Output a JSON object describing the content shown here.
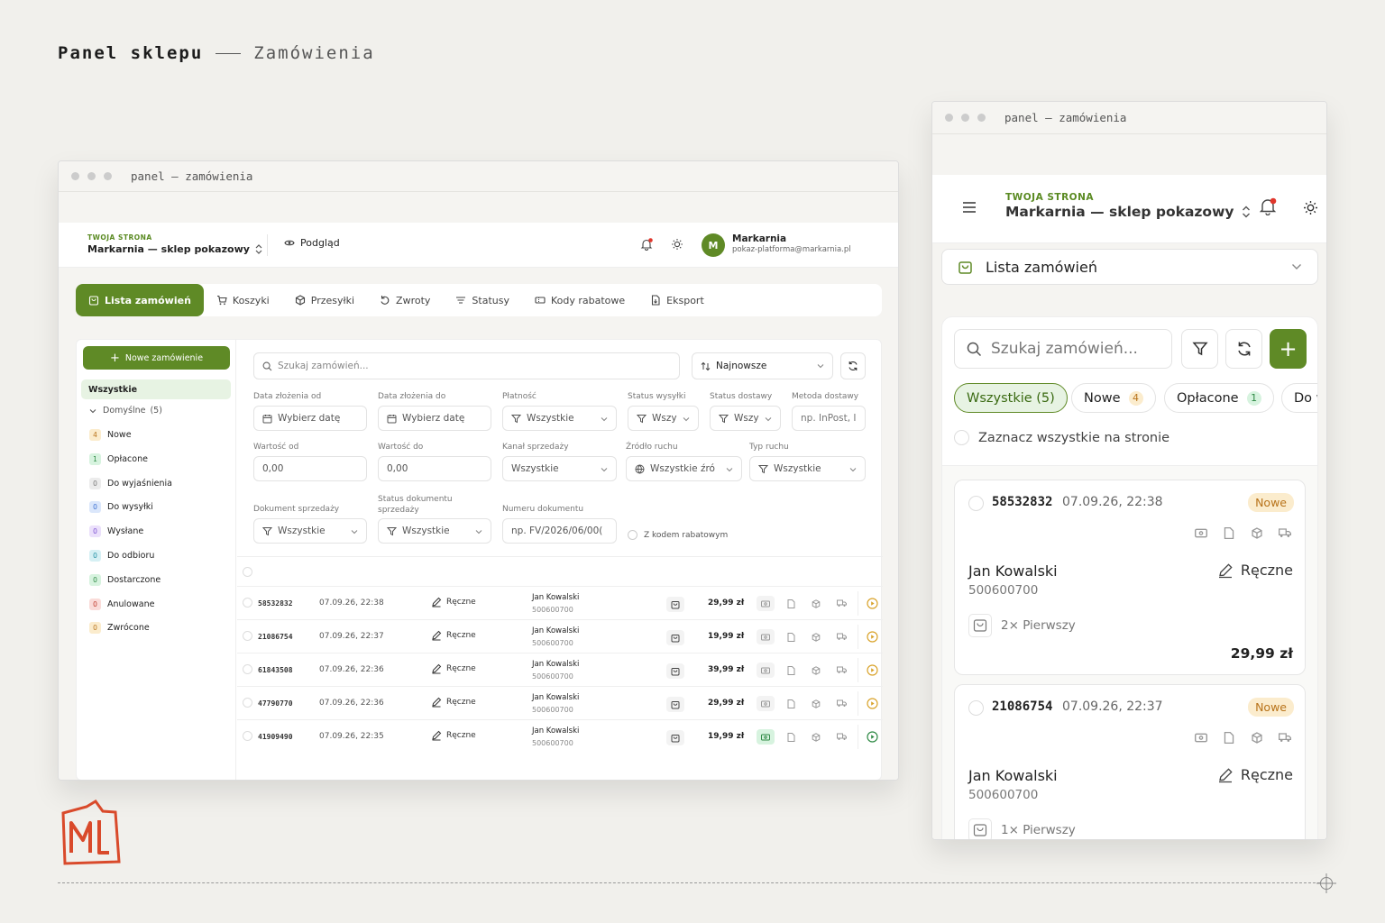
{
  "page": {
    "title": "Panel sklepu",
    "subtitle": "Zamówienia"
  },
  "desktop": {
    "window_title": "panel — zamówienia",
    "store_label": "TWOJA STRONA",
    "store_name": "Markarnia — sklep pokazowy",
    "preview": "Podgląd",
    "user": {
      "initial": "M",
      "name": "Markarnia",
      "email": "pokaz-platforma@markarnia.pl"
    },
    "tabs": [
      "Lista zamówień",
      "Koszyki",
      "Przesyłki",
      "Zwroty",
      "Statusy",
      "Kody rabatowe",
      "Eksport"
    ],
    "new_order": "Nowe zamówienie",
    "sidebar": {
      "all": "Wszystkie",
      "group": "Domyślne",
      "group_count": "(5)",
      "items": [
        {
          "count": "4",
          "label": "Nowe",
          "color": "#b8731a",
          "bg": "#fbeccd"
        },
        {
          "count": "1",
          "label": "Opłacone",
          "color": "#2f8a45",
          "bg": "#d7f3df"
        },
        {
          "count": "0",
          "label": "Do wyjaśnienia",
          "color": "#777",
          "bg": "#ececec"
        },
        {
          "count": "0",
          "label": "Do wysyłki",
          "color": "#3b6fd1",
          "bg": "#dbe7fb"
        },
        {
          "count": "0",
          "label": "Wysłane",
          "color": "#7b4fd1",
          "bg": "#ebe0fb"
        },
        {
          "count": "0",
          "label": "Do odbioru",
          "color": "#1f8fa3",
          "bg": "#d6f0f4"
        },
        {
          "count": "0",
          "label": "Dostarczone",
          "color": "#2f8a45",
          "bg": "#d7f3df"
        },
        {
          "count": "0",
          "label": "Anulowane",
          "color": "#c0392b",
          "bg": "#fadcd9"
        },
        {
          "count": "0",
          "label": "Zwrócone",
          "color": "#b8731a",
          "bg": "#fbeccd"
        }
      ]
    },
    "search_placeholder": "Szukaj zamówień...",
    "sort": "Najnowsze",
    "filters": {
      "date_from_label": "Data złożenia od",
      "date_from": "Wybierz datę",
      "date_to_label": "Data złożenia do",
      "date_to": "Wybierz datę",
      "payment_label": "Płatność",
      "payment": "Wszystkie",
      "ship_status_label": "Status wysyłki",
      "ship_status": "Wszy",
      "deliv_status_label": "Status dostawy",
      "deliv_status": "Wszy",
      "deliv_method_label": "Metoda dostawy",
      "deliv_method": "np. InPost, I",
      "value_from_label": "Wartość od",
      "value_from": "0,00",
      "value_to_label": "Wartość do",
      "value_to": "0,00",
      "channel_label": "Kanał sprzedaży",
      "channel": "Wszystkie",
      "traffic_src_label": "Źródło ruchu",
      "traffic_src": "Wszystkie źró",
      "traffic_type_label": "Typ ruchu",
      "traffic_type": "Wszystkie",
      "doc_label": "Dokument sprzedaży",
      "doc": "Wszystkie",
      "doc_status_label": "Status dokumentu sprzedaży",
      "doc_status": "Wszystkie",
      "doc_number_label": "Numeru dokumentu",
      "doc_number": "np. FV/2026/06/00(",
      "discount": "Z kodem rabatowym"
    },
    "orders": [
      {
        "id": "58532832",
        "date": "07.09.26, 22:38",
        "source": "Ręczne",
        "customer": "Jan Kowalski",
        "phone": "500600700",
        "price": "29,99 zł",
        "paid": false
      },
      {
        "id": "21086754",
        "date": "07.09.26, 22:37",
        "source": "Ręczne",
        "customer": "Jan Kowalski",
        "phone": "500600700",
        "price": "19,99 zł",
        "paid": false
      },
      {
        "id": "61843508",
        "date": "07.09.26, 22:36",
        "source": "Ręczne",
        "customer": "Jan Kowalski",
        "phone": "500600700",
        "price": "39,99 zł",
        "paid": false
      },
      {
        "id": "47790770",
        "date": "07.09.26, 22:36",
        "source": "Ręczne",
        "customer": "Jan Kowalski",
        "phone": "500600700",
        "price": "29,99 zł",
        "paid": false
      },
      {
        "id": "41909490",
        "date": "07.09.26, 22:35",
        "source": "Ręczne",
        "customer": "Jan Kowalski",
        "phone": "500600700",
        "price": "19,99 zł",
        "paid": true
      }
    ]
  },
  "mobile": {
    "window_title": "panel — zamówienia",
    "store_label": "TWOJA STRONA",
    "store_name": "Markarnia — sklep pokazowy",
    "section": "Lista zamówień",
    "search_placeholder": "Szukaj zamówień...",
    "chips": [
      {
        "label": "Wszystkie (5)",
        "count": ""
      },
      {
        "label": "Nowe",
        "count": "4"
      },
      {
        "label": "Opłacone",
        "count": "1"
      },
      {
        "label": "Do w",
        "count": ""
      }
    ],
    "select_all": "Zaznacz wszystkie na stronie",
    "cards": [
      {
        "id": "58532832",
        "date": "07.09.26, 22:38",
        "status": "Nowe",
        "customer": "Jan Kowalski",
        "phone": "500600700",
        "source": "Ręczne",
        "items": "2× Pierwszy",
        "price": "29,99 zł"
      },
      {
        "id": "21086754",
        "date": "07.09.26, 22:37",
        "status": "Nowe",
        "customer": "Jan Kowalski",
        "phone": "500600700",
        "source": "Ręczne",
        "items": "1× Pierwszy",
        "price": ""
      }
    ]
  },
  "colors": {
    "accent": "#5f8a26",
    "background": "#f1f0ec",
    "status_new": "#fbeccd",
    "logo": "#d94a2b"
  }
}
